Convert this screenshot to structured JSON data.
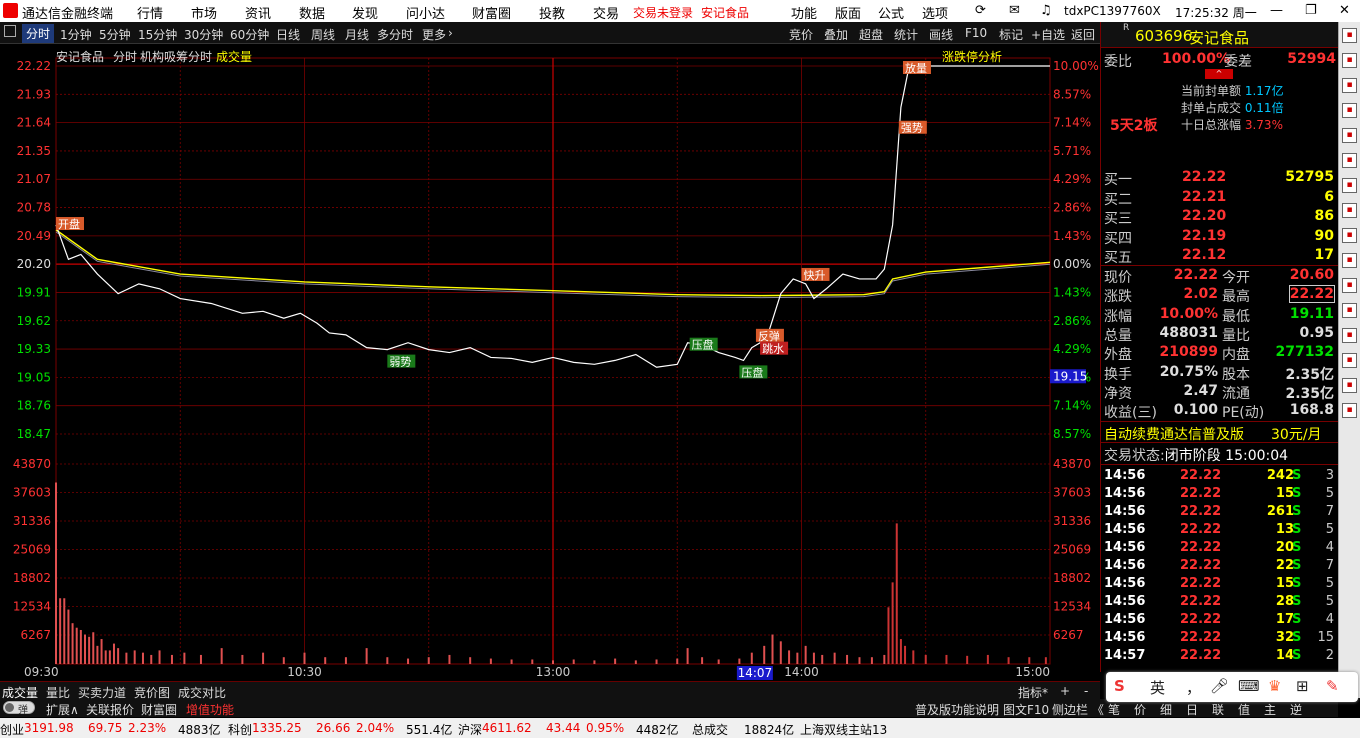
{
  "titlebar": {
    "app_title": "通达信金融终端",
    "menu": [
      "行情",
      "市场",
      "资讯",
      "数据",
      "发现",
      "问小达",
      "财富圈",
      "投教",
      "交易"
    ],
    "trade_status": "交易未登录",
    "stock_name": "安记食品",
    "right_menu": [
      "功能",
      "版面",
      "公式",
      "选项"
    ],
    "user_id": "tdxPC1397760X",
    "clock": "17:25:32 周一"
  },
  "toolbar": {
    "periods": [
      "分时",
      "1分钟",
      "5分钟",
      "15分钟",
      "30分钟",
      "60分钟",
      "日线",
      "周线",
      "月线",
      "多分时",
      "更多"
    ],
    "right_tools": [
      "竞价",
      "叠加",
      "超盘",
      "统计",
      "画线",
      "F10",
      "标记",
      "+自选",
      "返回"
    ]
  },
  "chart": {
    "header_name": "安记食品",
    "header_mode": "分时",
    "header_indicator": "机构吸筹分时",
    "header_volume": "成交量",
    "limit_button": "涨跌停分析",
    "price_ticks": [
      "22.22",
      "21.93",
      "21.64",
      "21.35",
      "21.07",
      "20.78",
      "20.49",
      "20.20",
      "19.91",
      "19.62",
      "19.33",
      "19.05",
      "18.76",
      "18.47"
    ],
    "pct_ticks": [
      "10.00%",
      "8.57%",
      "7.14%",
      "5.71%",
      "4.29%",
      "2.86%",
      "1.43%",
      "0.00%",
      "1.43%",
      "2.86%",
      "4.29%",
      "5.71%",
      "7.14%",
      "8.57%"
    ],
    "volume_ticks": [
      "43870",
      "37603",
      "31336",
      "25069",
      "18802",
      "12534",
      "6267"
    ],
    "time_ticks": [
      "09:30",
      "10:30",
      "13:00",
      "14:00",
      "15:00"
    ],
    "cursor_time": "14:07",
    "cursor_price": "19.15",
    "annotations": {
      "open": "开盘",
      "weak": "弱势",
      "press1": "压盘",
      "press2": "压盘",
      "rebound": "反弹",
      "dive": "跳水",
      "rise": "快升",
      "strong": "强势",
      "volume_up": "放量"
    },
    "colors": {
      "up": "#ff3232",
      "down": "#00e000",
      "price_line": "#ffffff",
      "avg_line": "#ffff00",
      "grid": "#7a0000"
    }
  },
  "chart_data": {
    "type": "line",
    "title": "安记食品 分时",
    "prev_close": 20.2,
    "ylim": [
      18.47,
      22.22
    ],
    "price_series": [
      [
        0,
        20.6
      ],
      [
        6,
        20.25
      ],
      [
        12,
        20.3
      ],
      [
        20,
        20.1
      ],
      [
        30,
        19.9
      ],
      [
        40,
        20.0
      ],
      [
        50,
        19.95
      ],
      [
        60,
        19.85
      ],
      [
        75,
        19.8
      ],
      [
        90,
        19.7
      ],
      [
        100,
        19.72
      ],
      [
        110,
        19.65
      ],
      [
        118,
        19.7
      ],
      [
        126,
        19.6
      ],
      [
        132,
        19.5
      ],
      [
        140,
        19.48
      ],
      [
        150,
        19.35
      ],
      [
        160,
        19.33
      ],
      [
        170,
        19.4
      ],
      [
        180,
        19.33
      ],
      [
        190,
        19.3
      ],
      [
        200,
        19.35
      ],
      [
        210,
        19.25
      ],
      [
        220,
        19.24
      ],
      [
        230,
        19.2
      ],
      [
        240,
        19.25
      ],
      [
        250,
        19.2
      ],
      [
        260,
        19.18
      ],
      [
        270,
        19.22
      ],
      [
        280,
        19.28
      ],
      [
        290,
        19.15
      ],
      [
        300,
        19.18
      ],
      [
        305,
        19.4
      ],
      [
        312,
        19.38
      ],
      [
        320,
        19.3
      ],
      [
        328,
        19.25
      ],
      [
        332,
        19.22
      ],
      [
        336,
        19.35
      ],
      [
        340,
        19.4
      ],
      [
        344,
        19.5
      ],
      [
        350,
        19.9
      ],
      [
        356,
        20.05
      ],
      [
        362,
        20.0
      ],
      [
        366,
        19.85
      ],
      [
        372,
        19.95
      ],
      [
        380,
        20.1
      ],
      [
        388,
        20.05
      ],
      [
        396,
        20.05
      ],
      [
        400,
        20.15
      ],
      [
        404,
        20.6
      ],
      [
        408,
        21.8
      ],
      [
        412,
        22.22
      ],
      [
        420,
        22.22
      ],
      [
        431,
        22.22
      ],
      [
        440,
        22.22
      ],
      [
        480,
        22.22
      ]
    ],
    "avg_series": [
      [
        0,
        20.55
      ],
      [
        20,
        20.25
      ],
      [
        60,
        20.1
      ],
      [
        120,
        20.02
      ],
      [
        180,
        19.97
      ],
      [
        240,
        19.93
      ],
      [
        300,
        19.89
      ],
      [
        340,
        19.88
      ],
      [
        390,
        19.89
      ],
      [
        400,
        19.92
      ],
      [
        404,
        20.05
      ],
      [
        420,
        20.12
      ],
      [
        480,
        20.22
      ]
    ],
    "volume": {
      "max": 43870,
      "bars": [
        [
          0,
          40000
        ],
        [
          2,
          14500
        ],
        [
          4,
          14500
        ],
        [
          6,
          12000
        ],
        [
          8,
          9000
        ],
        [
          10,
          8000
        ],
        [
          12,
          7500
        ],
        [
          14,
          6500
        ],
        [
          16,
          6000
        ],
        [
          18,
          7000
        ],
        [
          20,
          4000
        ],
        [
          22,
          5500
        ],
        [
          24,
          3000
        ],
        [
          26,
          3000
        ],
        [
          28,
          4500
        ],
        [
          30,
          3500
        ],
        [
          34,
          2500
        ],
        [
          38,
          3000
        ],
        [
          42,
          2500
        ],
        [
          46,
          2000
        ],
        [
          50,
          3000
        ],
        [
          56,
          2000
        ],
        [
          62,
          2500
        ],
        [
          70,
          2000
        ],
        [
          80,
          3500
        ],
        [
          90,
          2000
        ],
        [
          100,
          2500
        ],
        [
          110,
          1500
        ],
        [
          120,
          2500
        ],
        [
          130,
          1500
        ],
        [
          140,
          1500
        ],
        [
          150,
          3500
        ],
        [
          160,
          1500
        ],
        [
          170,
          1200
        ],
        [
          180,
          1500
        ],
        [
          190,
          2000
        ],
        [
          200,
          1500
        ],
        [
          210,
          1200
        ],
        [
          220,
          1000
        ],
        [
          230,
          1000
        ],
        [
          240,
          800
        ],
        [
          250,
          1000
        ],
        [
          260,
          800
        ],
        [
          270,
          1200
        ],
        [
          280,
          800
        ],
        [
          290,
          1000
        ],
        [
          300,
          1200
        ],
        [
          305,
          3500
        ],
        [
          312,
          1500
        ],
        [
          320,
          1000
        ],
        [
          330,
          1200
        ],
        [
          336,
          2500
        ],
        [
          342,
          4000
        ],
        [
          346,
          6500
        ],
        [
          350,
          5000
        ],
        [
          354,
          3000
        ],
        [
          358,
          2500
        ],
        [
          362,
          4000
        ],
        [
          366,
          2500
        ],
        [
          370,
          2000
        ],
        [
          376,
          2500
        ],
        [
          382,
          2000
        ],
        [
          388,
          1500
        ],
        [
          394,
          1500
        ],
        [
          400,
          2000
        ],
        [
          402,
          12500
        ],
        [
          404,
          18000
        ],
        [
          406,
          31000
        ],
        [
          408,
          5500
        ],
        [
          410,
          4000
        ],
        [
          414,
          3000
        ],
        [
          420,
          2000
        ],
        [
          430,
          2000
        ],
        [
          440,
          1800
        ],
        [
          450,
          2000
        ],
        [
          460,
          1500
        ],
        [
          470,
          1500
        ],
        [
          478,
          1500
        ]
      ]
    }
  },
  "rightpanel": {
    "code": "603696",
    "name": "安记食品",
    "weibi_label": "委比",
    "weibi_val": "100.00%",
    "weicha_label": "委差",
    "weicha_val": "52994",
    "seal_amount_label": "当前封单额",
    "seal_amount_val": "1.17亿",
    "seal_ratio_label": "封单占成交",
    "seal_ratio_val": "0.11倍",
    "ten_day_label": "十日总涨幅",
    "ten_day_val": "3.73%",
    "board_tag": "5天2板",
    "bids": [
      {
        "label": "买一",
        "price": "22.22",
        "vol": "52795"
      },
      {
        "label": "买二",
        "price": "22.21",
        "vol": "6"
      },
      {
        "label": "买三",
        "price": "22.20",
        "vol": "86"
      },
      {
        "label": "买四",
        "price": "22.19",
        "vol": "90"
      },
      {
        "label": "买五",
        "price": "22.12",
        "vol": "17"
      }
    ],
    "quote": [
      {
        "l1": "现价",
        "v1": "22.22",
        "l2": "今开",
        "v2": "20.60"
      },
      {
        "l1": "涨跌",
        "v1": "2.02",
        "l2": "最高",
        "v2": "22.22"
      },
      {
        "l1": "涨幅",
        "v1": "10.00%",
        "l2": "最低",
        "v2": "19.11"
      },
      {
        "l1": "总量",
        "v1": "488031",
        "l2": "量比",
        "v2": "0.95"
      },
      {
        "l1": "外盘",
        "v1": "210899",
        "l2": "内盘",
        "v2": "277132"
      },
      {
        "l1": "换手",
        "v1": "20.75%",
        "l2": "股本",
        "v2": "2.35亿"
      },
      {
        "l1": "净资",
        "v1": "2.47",
        "l2": "流通",
        "v2": "2.35亿"
      },
      {
        "l1": "收益(三)",
        "v1": "0.100",
        "l2": "PE(动)",
        "v2": "168.8"
      }
    ],
    "ad_text": "自动续费通达信普及版",
    "ad_price": "30元/月",
    "trade_state_label": "交易状态:",
    "trade_state_val": "闭市阶段 15:00:04",
    "ticks": [
      {
        "t": "14:56",
        "p": "22.22",
        "v": "242",
        "d": "S",
        "n": "3"
      },
      {
        "t": "14:56",
        "p": "22.22",
        "v": "15",
        "d": "S",
        "n": "5"
      },
      {
        "t": "14:56",
        "p": "22.22",
        "v": "261",
        "d": "S",
        "n": "7"
      },
      {
        "t": "14:56",
        "p": "22.22",
        "v": "13",
        "d": "S",
        "n": "5"
      },
      {
        "t": "14:56",
        "p": "22.22",
        "v": "20",
        "d": "S",
        "n": "4"
      },
      {
        "t": "14:56",
        "p": "22.22",
        "v": "22",
        "d": "S",
        "n": "7"
      },
      {
        "t": "14:56",
        "p": "22.22",
        "v": "15",
        "d": "S",
        "n": "5"
      },
      {
        "t": "14:56",
        "p": "22.22",
        "v": "28",
        "d": "S",
        "n": "5"
      },
      {
        "t": "14:56",
        "p": "22.22",
        "v": "17",
        "d": "S",
        "n": "4"
      },
      {
        "t": "14:56",
        "p": "22.22",
        "v": "32",
        "d": "S",
        "n": "15"
      },
      {
        "t": "14:57",
        "p": "22.22",
        "v": "14",
        "d": "S",
        "n": "2"
      }
    ]
  },
  "bottomtabs": {
    "tabs": [
      "成交量",
      "量比",
      "买卖力道",
      "竞价图",
      "成交对比"
    ],
    "indicator": "指标*",
    "plus": "+",
    "minus": "-"
  },
  "bottomtabs2": {
    "toggle": "弹",
    "tabs": [
      "扩展∧",
      "关联报价",
      "财富圈",
      "增值功能"
    ],
    "right_tabs": [
      "普及版功能说明",
      "图文F10",
      "侧边栏 《"
    ],
    "panel_tabs": [
      "笔",
      "价",
      "细",
      "日",
      "联",
      "值",
      "主",
      "逆"
    ]
  },
  "status": {
    "items": [
      {
        "name": "创业",
        "val": "3191.98",
        "chg": "69.75",
        "pct": "2.23%",
        "amt": "4883亿"
      },
      {
        "name": "科创",
        "val": "1335.25",
        "chg": "26.66",
        "pct": "2.04%",
        "amt": "551.4亿"
      },
      {
        "name": "沪深",
        "val": "4611.62",
        "chg": "43.44",
        "pct": "0.95%",
        "amt": "4482亿"
      }
    ],
    "total_label": "总成交",
    "total_val": "18824亿",
    "server": "上海双线主站13"
  },
  "ime": {
    "items": [
      "英",
      "，",
      "麦克风",
      "键盘",
      "皮肤",
      "工具",
      "更多"
    ]
  }
}
